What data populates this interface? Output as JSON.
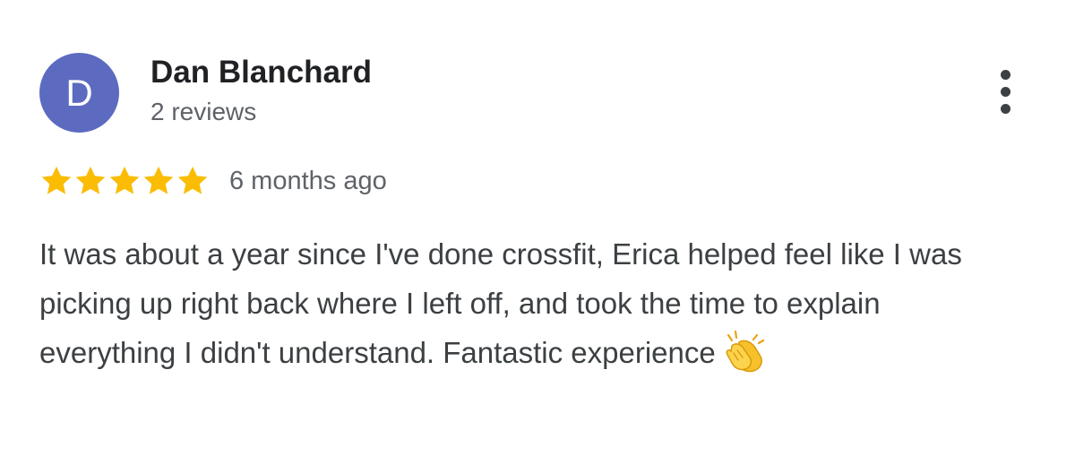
{
  "review": {
    "author": {
      "initial": "D",
      "name": "Dan Blanchard",
      "review_count": "2 reviews",
      "avatar_color": "#5c6bc0"
    },
    "rating": {
      "value": 5,
      "max": 5,
      "star_color": "#fbbc04"
    },
    "time_ago": "6 months ago",
    "text": "It was about a year since I've done crossfit, Erica helped feel like I was picking up right back where I left off, and took the time to explain everything I didn't understand. Fantastic experience",
    "emoji": "clapping-hands-icon"
  },
  "menu": {
    "icon": "more-vertical-icon"
  }
}
